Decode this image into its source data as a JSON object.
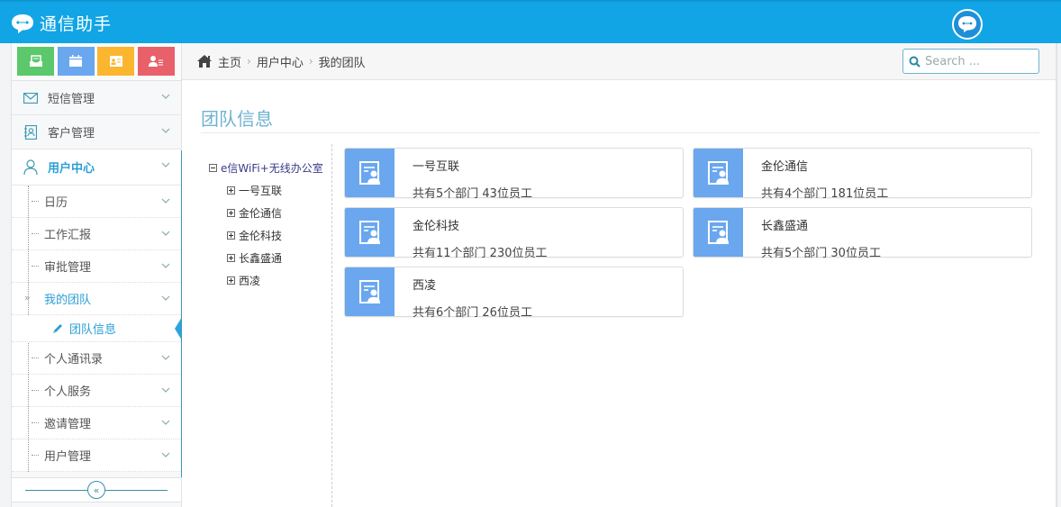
{
  "app": {
    "title": "通信助手",
    "brand_icon": "chat-bubble-icon",
    "avatar_icon": "robot-chat-avatar-icon"
  },
  "shortcuts": [
    {
      "name": "inbox",
      "icon": "inbox-icon",
      "color": "#5bc86b"
    },
    {
      "name": "calendar",
      "icon": "calendar-icon",
      "color": "#6aa7ef"
    },
    {
      "name": "contact-card",
      "icon": "contact-card-icon",
      "color": "#fbb52e"
    },
    {
      "name": "user-list",
      "icon": "user-list-icon",
      "color": "#e8606a"
    }
  ],
  "sidebar": {
    "menu": [
      {
        "label": "短信管理",
        "icon": "envelope-icon"
      },
      {
        "label": "客户管理",
        "icon": "address-book-icon"
      },
      {
        "label": "用户中心",
        "icon": "user-icon",
        "open": true
      }
    ],
    "submenu": [
      {
        "label": "日历"
      },
      {
        "label": "工作汇报"
      },
      {
        "label": "审批管理"
      },
      {
        "label": "我的团队",
        "active": true
      },
      {
        "label": "团队信息",
        "leaf": true
      },
      {
        "label": "个人通讯录"
      },
      {
        "label": "个人服务"
      },
      {
        "label": "邀请管理"
      },
      {
        "label": "用户管理"
      }
    ],
    "collapse_glyph": "«"
  },
  "breadcrumb": {
    "items": [
      "主页",
      "用户中心",
      "我的团队"
    ],
    "separator": "›"
  },
  "search": {
    "placeholder": "Search ..."
  },
  "page": {
    "title": "团队信息"
  },
  "tree": {
    "root": "e信WiFi+无线办公室",
    "children": [
      "一号互联",
      "金伦通信",
      "金伦科技",
      "长鑫盛通",
      "西凌"
    ]
  },
  "teams": [
    {
      "name": "一号互联",
      "stats": "共有5个部门 43位员工",
      "departments": 5,
      "employees": 43
    },
    {
      "name": "金伦通信",
      "stats": "共有4个部门 181位员工",
      "departments": 4,
      "employees": 181
    },
    {
      "name": "金伦科技",
      "stats": "共有11个部门 230位员工",
      "departments": 11,
      "employees": 230
    },
    {
      "name": "长鑫盛通",
      "stats": "共有5个部门 30位员工",
      "departments": 5,
      "employees": 30
    },
    {
      "name": "西凌",
      "stats": "共有6个部门 26位员工",
      "departments": 6,
      "employees": 26
    }
  ],
  "colors": {
    "topbar": "#12a5e6",
    "accent": "#2a9fd6",
    "card_icon_bg": "#6aa7ef",
    "title": "#6fb3d0"
  }
}
